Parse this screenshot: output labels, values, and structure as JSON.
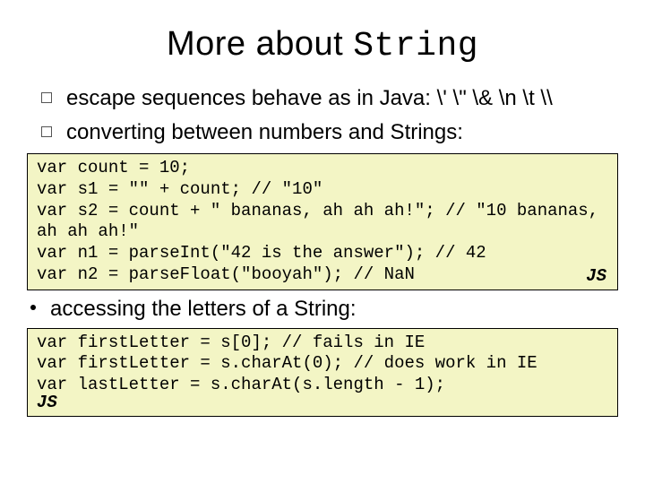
{
  "title_plain": "More about ",
  "title_mono": "String",
  "bullets": {
    "b1": "escape sequences behave as in Java: \\' \\\" \\& \\n \\t \\\\",
    "b2": "converting between numbers and Strings:",
    "b3": "accessing the letters of a String:"
  },
  "code1": {
    "text": "var count = 10;\nvar s1 = \"\" + count; // \"10\"\nvar s2 = count + \" bananas, ah ah ah!\"; // \"10 bananas, ah ah ah!\"\nvar n1 = parseInt(\"42 is the answer\"); // 42\nvar n2 = parseFloat(\"booyah\"); // NaN",
    "lang": "JS"
  },
  "code2": {
    "text": "var firstLetter = s[0]; // fails in IE\nvar firstLetter = s.charAt(0); // does work in IE\nvar lastLetter = s.charAt(s.length - 1);",
    "lang": "JS"
  }
}
